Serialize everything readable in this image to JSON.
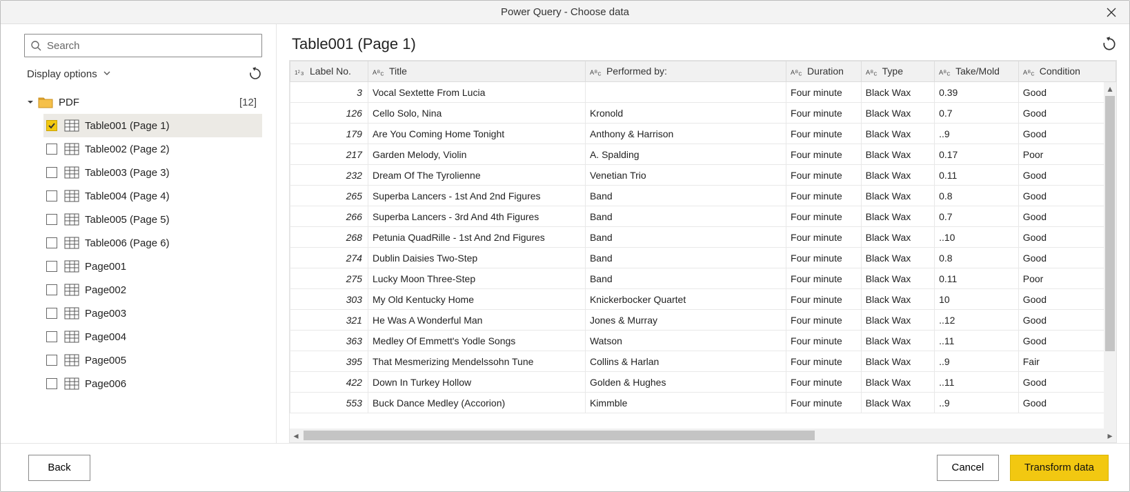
{
  "window": {
    "title": "Power Query - Choose data"
  },
  "left": {
    "search_placeholder": "Search",
    "display_options_label": "Display options",
    "root": {
      "label": "PDF",
      "count": "[12]"
    },
    "items": [
      {
        "label": "Table001 (Page 1)",
        "icon": "table",
        "checked": true,
        "selected": true
      },
      {
        "label": "Table002 (Page 2)",
        "icon": "table",
        "checked": false,
        "selected": false
      },
      {
        "label": "Table003 (Page 3)",
        "icon": "table",
        "checked": false,
        "selected": false
      },
      {
        "label": "Table004 (Page 4)",
        "icon": "table",
        "checked": false,
        "selected": false
      },
      {
        "label": "Table005 (Page 5)",
        "icon": "table",
        "checked": false,
        "selected": false
      },
      {
        "label": "Table006 (Page 6)",
        "icon": "table",
        "checked": false,
        "selected": false
      },
      {
        "label": "Page001",
        "icon": "table",
        "checked": false,
        "selected": false
      },
      {
        "label": "Page002",
        "icon": "table",
        "checked": false,
        "selected": false
      },
      {
        "label": "Page003",
        "icon": "table",
        "checked": false,
        "selected": false
      },
      {
        "label": "Page004",
        "icon": "table",
        "checked": false,
        "selected": false
      },
      {
        "label": "Page005",
        "icon": "table",
        "checked": false,
        "selected": false
      },
      {
        "label": "Page006",
        "icon": "table",
        "checked": false,
        "selected": false
      }
    ]
  },
  "right": {
    "heading": "Table001 (Page 1)",
    "columns": [
      {
        "label": "Label No.",
        "type": "num"
      },
      {
        "label": "Title",
        "type": "text"
      },
      {
        "label": "Performed by:",
        "type": "text"
      },
      {
        "label": "Duration",
        "type": "text"
      },
      {
        "label": "Type",
        "type": "text"
      },
      {
        "label": "Take/Mold",
        "type": "text"
      },
      {
        "label": "Condition",
        "type": "text"
      }
    ],
    "rows": [
      [
        "3",
        "Vocal Sextette From Lucia",
        "",
        "Four minute",
        "Black Wax",
        "0.39",
        "Good"
      ],
      [
        "126",
        "Cello Solo, Nina",
        "Kronold",
        "Four minute",
        "Black Wax",
        "0.7",
        "Good"
      ],
      [
        "179",
        "Are You Coming Home Tonight",
        "Anthony & Harrison",
        "Four minute",
        "Black Wax",
        "..9",
        "Good"
      ],
      [
        "217",
        "Garden Melody, Violin",
        "A. Spalding",
        "Four minute",
        "Black Wax",
        "0.17",
        "Poor"
      ],
      [
        "232",
        "Dream Of The Tyrolienne",
        "Venetian Trio",
        "Four minute",
        "Black Wax",
        "0.11",
        "Good"
      ],
      [
        "265",
        "Superba Lancers - 1st And 2nd Figures",
        "Band",
        "Four minute",
        "Black Wax",
        "0.8",
        "Good"
      ],
      [
        "266",
        "Superba Lancers - 3rd And 4th Figures",
        "Band",
        "Four minute",
        "Black Wax",
        "0.7",
        "Good"
      ],
      [
        "268",
        "Petunia QuadRille - 1st And 2nd Figures",
        "Band",
        "Four minute",
        "Black Wax",
        "..10",
        "Good"
      ],
      [
        "274",
        "Dublin Daisies Two-Step",
        "Band",
        "Four minute",
        "Black Wax",
        "0.8",
        "Good"
      ],
      [
        "275",
        "Lucky Moon Three-Step",
        "Band",
        "Four minute",
        "Black Wax",
        "0.11",
        "Poor"
      ],
      [
        "303",
        "My Old Kentucky Home",
        "Knickerbocker Quartet",
        "Four minute",
        "Black Wax",
        "10",
        "Good"
      ],
      [
        "321",
        "He Was A Wonderful Man",
        "Jones & Murray",
        "Four minute",
        "Black Wax",
        "..12",
        "Good"
      ],
      [
        "363",
        "Medley Of Emmett's Yodle Songs",
        "Watson",
        "Four minute",
        "Black Wax",
        "..11",
        "Good"
      ],
      [
        "395",
        "That Mesmerizing Mendelssohn Tune",
        "Collins & Harlan",
        "Four minute",
        "Black Wax",
        "..9",
        "Fair"
      ],
      [
        "422",
        "Down In Turkey Hollow",
        "Golden & Hughes",
        "Four minute",
        "Black Wax",
        "..11",
        "Good"
      ],
      [
        "553",
        "Buck Dance Medley (Accorion)",
        "Kimmble",
        "Four minute",
        "Black Wax",
        "..9",
        "Good"
      ]
    ]
  },
  "footer": {
    "back": "Back",
    "cancel": "Cancel",
    "transform": "Transform data"
  }
}
